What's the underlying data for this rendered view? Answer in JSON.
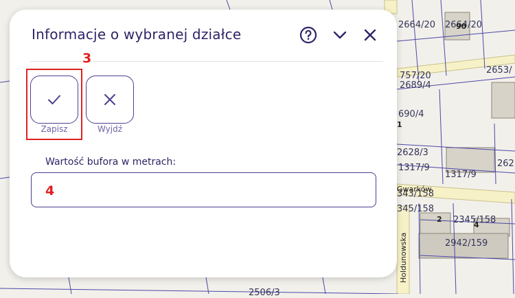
{
  "map": {
    "parcel_labels": [
      "2664/20",
      "2664/20",
      "2653/",
      "757/20",
      "2689/4",
      "690/4",
      "2628/3",
      "1317/9",
      "1317/9",
      "262",
      "343/158",
      "345/158",
      "2345/158",
      "2942/159",
      "2506/3"
    ],
    "building_numbers": [
      "90",
      "1",
      "2",
      "4"
    ],
    "streets": [
      "Gwarków",
      "Holdunowska"
    ]
  },
  "panel": {
    "title": "Informacje o wybranej działce",
    "help_icon": "help-circle-icon",
    "collapse_icon": "chevron-down-icon",
    "close_icon": "close-icon",
    "actions": {
      "save_label": "Zapisz",
      "save_icon": "check-icon",
      "exit_label": "Wyjdź",
      "exit_icon": "close-icon"
    },
    "buffer": {
      "label": "Wartość bufora w metrach:",
      "value": "",
      "placeholder": ""
    }
  },
  "annotations": {
    "marker_save": "3",
    "marker_input": "4",
    "color": "#e02020"
  },
  "colors": {
    "accent": "#2d2466",
    "panel_bg": "#ffffff",
    "map_bg": "#f2f0ea"
  }
}
